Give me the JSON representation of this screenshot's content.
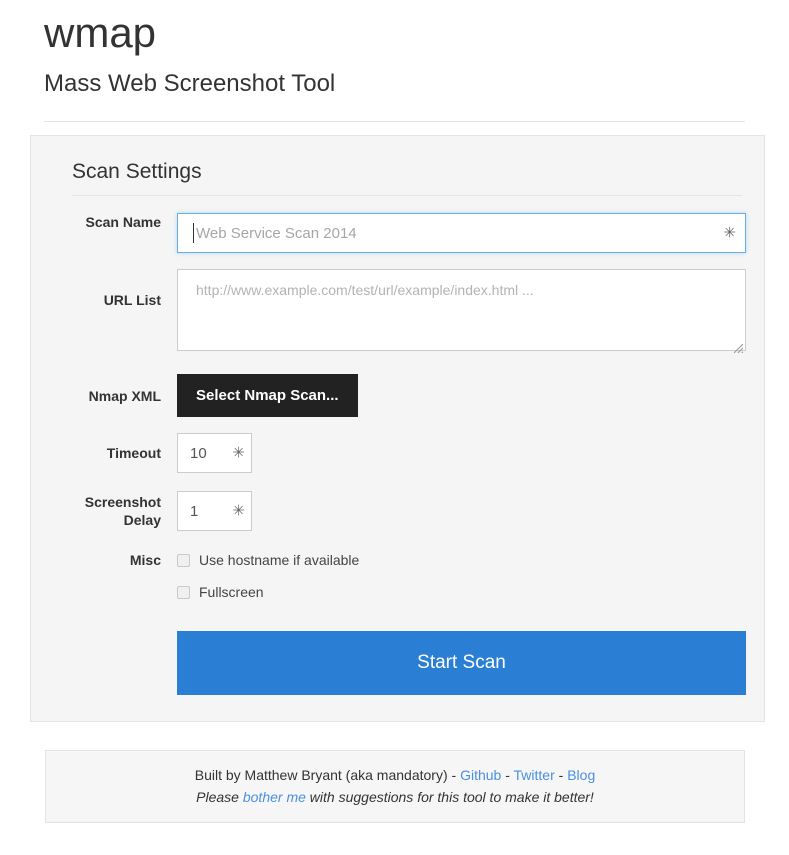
{
  "header": {
    "app_title": "wmap",
    "subtitle": "Mass Web Screenshot Tool"
  },
  "panel": {
    "title": "Scan Settings"
  },
  "form": {
    "scan_name": {
      "label": "Scan Name",
      "placeholder": "Web Service Scan 2014",
      "value": "",
      "required_marker": "✳",
      "focused": true
    },
    "url_list": {
      "label": "URL List",
      "placeholder": "http://www.example.com/test/url/example/index.html ...",
      "value": ""
    },
    "nmap_xml": {
      "label": "Nmap XML",
      "button_label": "Select Nmap Scan..."
    },
    "timeout": {
      "label": "Timeout",
      "value": "10",
      "required_marker": "✳"
    },
    "screenshot_delay": {
      "label": "Screenshot Delay",
      "label_line1": "Screenshot",
      "label_line2": "Delay",
      "value": "1",
      "required_marker": "✳"
    },
    "misc": {
      "label": "Misc",
      "options": [
        {
          "label": "Use hostname if available",
          "checked": false
        },
        {
          "label": "Fullscreen",
          "checked": false
        }
      ]
    },
    "submit": {
      "label": "Start Scan"
    }
  },
  "footer": {
    "line1_prefix": "Built by Matthew Bryant (aka mandatory) ",
    "sep": "- ",
    "links": [
      {
        "label": "Github"
      },
      {
        "label": "Twitter"
      },
      {
        "label": "Blog"
      }
    ],
    "line2_prefix": "Please ",
    "line2_link": "bother me",
    "line2_suffix": " with suggestions for this tool to make it better!"
  },
  "colors": {
    "primary_button": "#2a7fd4",
    "dark_button": "#222222",
    "panel_bg": "#f5f5f5",
    "link": "#4a90e2",
    "focus_border": "#66afe9"
  }
}
